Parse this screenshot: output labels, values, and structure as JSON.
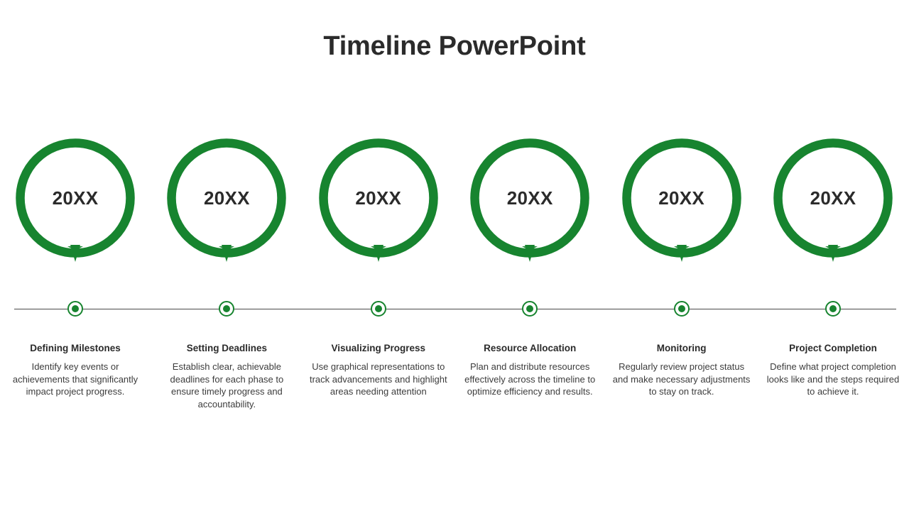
{
  "page": {
    "title": "Timeline PowerPoint",
    "background_color": "#ffffff",
    "accent_color": "#17842f",
    "text_color": "#2b2b2b",
    "body_text_color": "#3c3c3c",
    "axis_line_color": "#4a4a4a"
  },
  "timeline": {
    "axis_label": "timeline-axis",
    "steps": [
      {
        "year": "20XX",
        "title": "Defining Milestones",
        "description": "Identify key events or achievements that significantly impact project progress."
      },
      {
        "year": "20XX",
        "title": "Setting Deadlines",
        "description": "Establish clear, achievable deadlines for each phase to ensure timely progress and accountability."
      },
      {
        "year": "20XX",
        "title": "Visualizing Progress",
        "description": "Use graphical representations to track advancements and highlight areas needing attention"
      },
      {
        "year": "20XX",
        "title": "Resource Allocation",
        "description": "Plan and distribute resources effectively across the timeline to optimize efficiency and results."
      },
      {
        "year": "20XX",
        "title": "Monitoring",
        "description": "Regularly review project status and make necessary adjustments to stay on track."
      },
      {
        "year": "20XX",
        "title": "Project Completion",
        "description": "Define what project completion looks like and the steps required to achieve it."
      }
    ]
  }
}
